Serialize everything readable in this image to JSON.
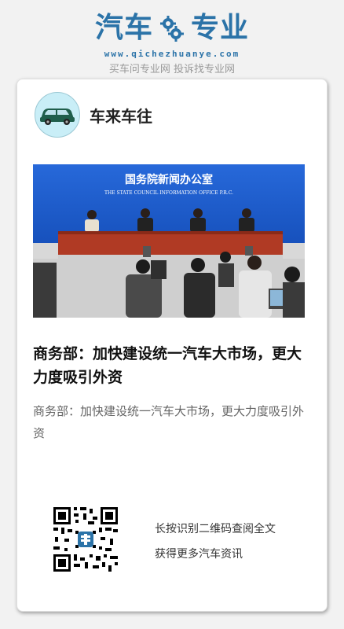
{
  "brand": {
    "logo_left": "汽车",
    "logo_right": "专业",
    "url": "www.qichezhuanye.com",
    "tagline": "买车问专业网 投诉找专业网",
    "color": "#2b73a8"
  },
  "card": {
    "profile_name": "车来车往",
    "photo": {
      "banner_title": "国务院新闻办公室",
      "banner_subtitle": "THE STATE COUNCIL INFORMATION OFFICE P.R.C."
    },
    "headline": "商务部：加快建设统一汽车大市场，更大力度吸引外资",
    "summary": "商务部：加快建设统一汽车大市场，更大力度吸引外资",
    "qr_caption_line1": "长按识别二维码查阅全文",
    "qr_caption_line2": "获得更多汽车资讯"
  },
  "colors": {
    "banner_blue": "#1e5fd0",
    "podium_red": "#b03a24",
    "avatar_bg": "#c9eef7"
  }
}
